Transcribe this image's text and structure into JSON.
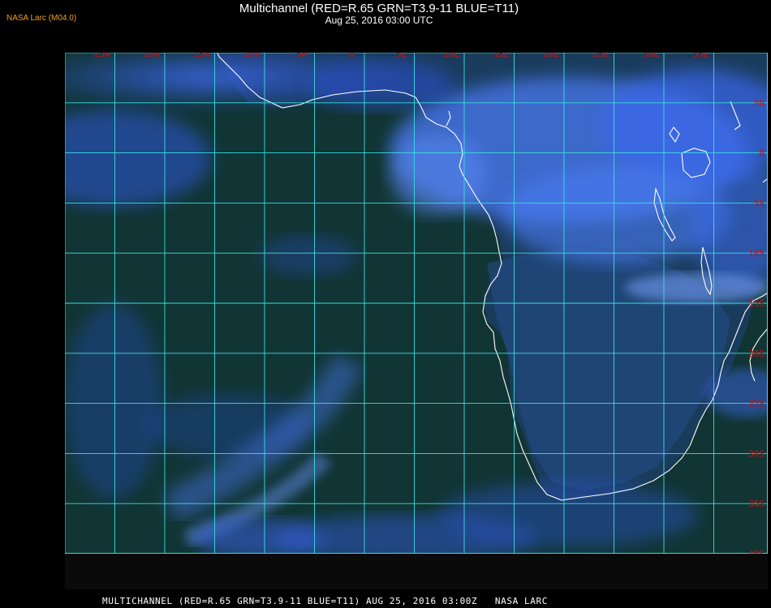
{
  "credit": "NASA Larc (M04.0)",
  "title": "Multichannel (RED=R.65 GRN=T3.9-11 BLUE=T11)",
  "subtitle": "Aug 25, 2016 03:00 UTC",
  "footer": "MULTICHANNEL (RED=R.65 GRN=T3.9-11 BLUE=T11) AUG 25, 2016 03:00Z   NASA LARC",
  "longitude_labels": [
    "25W",
    "20W",
    "15W",
    "10W",
    "5W",
    "0",
    "5E",
    "10E",
    "15E",
    "20E",
    "25E",
    "30E",
    "35E"
  ],
  "latitude_labels": [
    "5N",
    "0",
    "5S",
    "10S",
    "15S",
    "20S",
    "25S",
    "30S",
    "35S",
    "40S"
  ],
  "colors": {
    "grid": "#38e0e0",
    "grid_label": "#d01010",
    "coast": "#ffffff",
    "credit": "#f0a020",
    "ocean": "#0d2a1c",
    "cloud": "#3a66e8"
  }
}
